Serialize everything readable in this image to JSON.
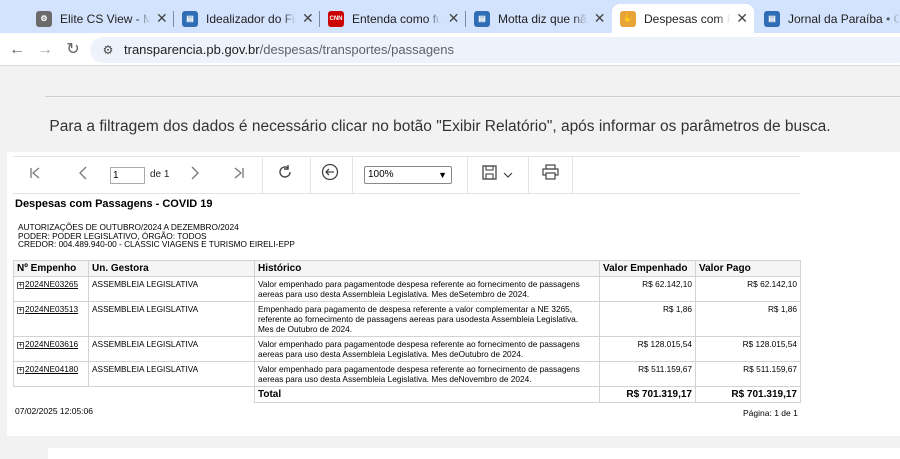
{
  "browser": {
    "tabs": [
      {
        "title": "Elite CS View - Mundi",
        "favicon": "elite",
        "color": "#6b6b6b",
        "active": false
      },
      {
        "title": "Idealizador do Ficha L",
        "favicon": "doc",
        "color": "#2f6db5",
        "active": false
      },
      {
        "title": "Entenda como funcio",
        "favicon": "CNN",
        "color": "#cc0000",
        "active": false
      },
      {
        "title": "Motta diz que não há",
        "favicon": "doc",
        "color": "#2f6db5",
        "active": false
      },
      {
        "title": "Despesas com Passag",
        "favicon": "hand",
        "color": "#e8a33b",
        "active": true
      },
      {
        "title": "Jornal da Paraíba • O",
        "favicon": "doc",
        "color": "#2f6db5",
        "active": false
      }
    ],
    "close_glyph": "✕",
    "url_host": "transparencia.pb.gov.br",
    "url_path": "/despesas/transportes/passagens"
  },
  "page": {
    "instruction": "Para a filtragem dos dados é necessário clicar no botão \"Exibir Relatório\", após informar os parâmetros de busca."
  },
  "report_toolbar": {
    "page_value": "1",
    "of_label": "de 1",
    "zoom_value": "100%"
  },
  "report": {
    "title": "Despesas com Passagens - COVID 19",
    "meta_lines": [
      "AUTORIZAÇÕES DE OUTUBRO/2024 A DEZEMBRO/2024",
      "PODER: PODER LEGISLATIVO, ÓRGÃO:  TODOS",
      "CREDOR: 004.489.940-00 - CLASSIC VIAGENS E TURISMO EIRELI-EPP"
    ],
    "columns": [
      "Nº Empenho",
      "Un. Gestora",
      "Histórico",
      "Valor Empenhado",
      "Valor Pago"
    ],
    "rows": [
      {
        "empenho": "2024NE03265",
        "gestora": "ASSEMBLEIA LEGISLATIVA",
        "historico": "Valor empenhado para pagamentode despesa referente ao       fornecimento de passagens aereas para uso desta          Assembleia Legislativa. Mes deSetembro de 2024.",
        "empenhado": "R$ 62.142,10",
        "pago": "R$ 62.142,10"
      },
      {
        "empenho": "2024NE03513",
        "gestora": "ASSEMBLEIA LEGISLATIVA",
        "historico": "Empenhado para pagamento de    despesa referente a valor     complementar a NE 3265, referente ao fornecimento de  passagens aereas para usodesta Assembleia Legislativa. Mes de Outubro de 2024.",
        "empenhado": "R$ 1,86",
        "pago": "R$ 1,86"
      },
      {
        "empenho": "2024NE03616",
        "gestora": "ASSEMBLEIA LEGISLATIVA",
        "historico": "Valor empenhado para pagamentode despesa referente ao       fornecimento de passagens aereas para uso desta          Assembleia Legislativa. Mes deOutubro de 2024.",
        "empenhado": "R$ 128.015,54",
        "pago": "R$ 128.015,54"
      },
      {
        "empenho": "2024NE04180",
        "gestora": "ASSEMBLEIA LEGISLATIVA",
        "historico": "Valor empenhado para pagamentode despesa referente ao       fornecimento de passagens aereas para uso desta          Assembleia Legislativa. Mes deNovembro de 2024.",
        "empenhado": "R$ 511.159,67",
        "pago": "R$ 511.159,67"
      }
    ],
    "total_label": "Total",
    "total_empenhado": "R$ 701.319,17",
    "total_pago": "R$ 701.319,17",
    "timestamp": "07/02/2025 12:05:06",
    "pagination": "Página: 1 de 1"
  }
}
